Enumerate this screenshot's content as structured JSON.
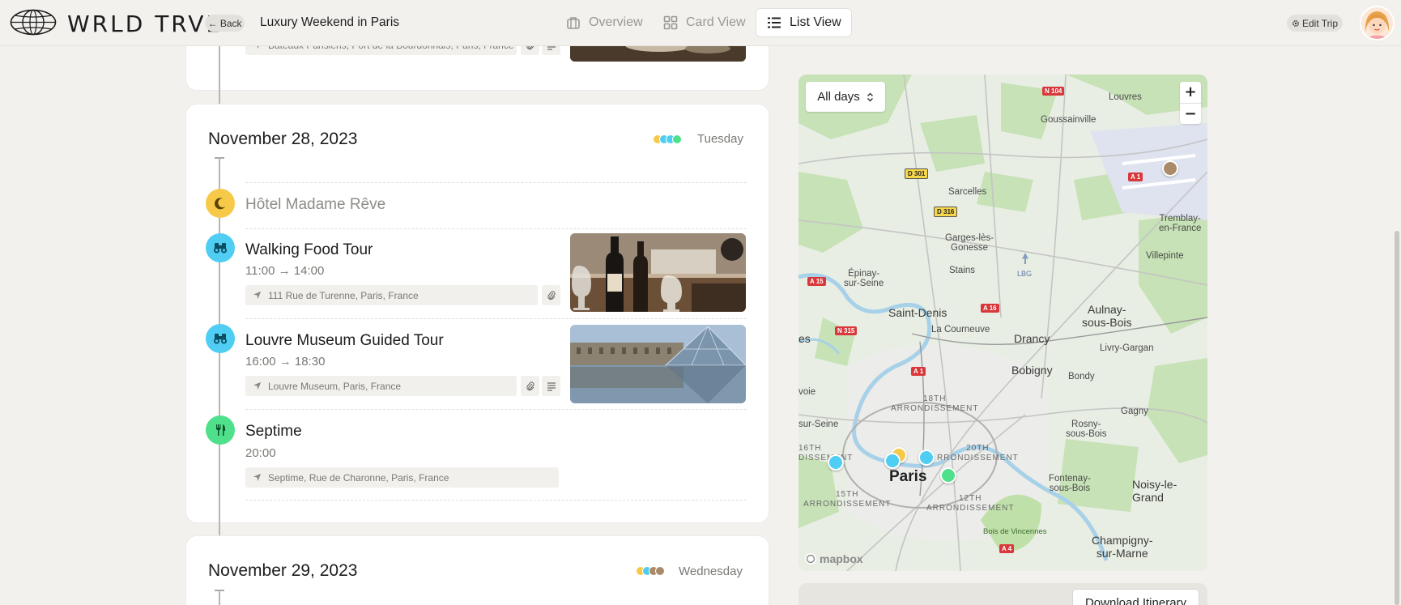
{
  "header": {
    "logo_text": "WRLD TRVL",
    "back_label": "← Back",
    "trip_title": "Luxury Weekend in Paris",
    "tabs": [
      {
        "label": "Overview",
        "icon": "bag-icon",
        "active": false
      },
      {
        "label": "Card View",
        "icon": "grid-icon",
        "active": false
      },
      {
        "label": "List View",
        "icon": "list-icon",
        "active": true
      }
    ],
    "edit_trip_label": "Edit Trip"
  },
  "prev_day": {
    "address": "Bateaux Parisiens, Port de la Bourdonnais, Paris, France"
  },
  "day": {
    "date": "November 28, 2023",
    "weekday": "Tuesday",
    "dot_colors": [
      "#f7c948",
      "#4fcdf2",
      "#4fcdf2",
      "#4ee08a"
    ],
    "items": [
      {
        "type": "lodging",
        "title": "Hôtel Madame Rêve",
        "icon": "moon-icon",
        "color": "#f7c948"
      },
      {
        "type": "activity",
        "title": "Walking Food Tour",
        "time": "11:00 → 14:00",
        "address": "111 Rue de Turenne, Paris, France",
        "icon": "binoculars-icon",
        "color": "#4fcdf2"
      },
      {
        "type": "activity",
        "title": "Louvre Museum Guided Tour",
        "time": "16:00 → 18:30",
        "address": "Louvre Museum, Paris, France",
        "icon": "binoculars-icon",
        "color": "#4fcdf2"
      },
      {
        "type": "restaurant",
        "title": "Septime",
        "time": "20:00",
        "address": "Septime, Rue de Charonne, Paris, France",
        "icon": "fork-knife-icon",
        "color": "#4ee08a"
      }
    ]
  },
  "next_day": {
    "date": "November 29, 2023",
    "weekday": "Wednesday",
    "dot_colors": [
      "#f7c948",
      "#4fcdf2",
      "#a98b6a",
      "#a98b6a"
    ]
  },
  "map": {
    "filter_label": "All days",
    "zoom_in": "+",
    "zoom_out": "−",
    "attribution": "mapbox",
    "labels": {
      "louvres": "Louvres",
      "goussainville": "Goussainville",
      "sarcelles": "Sarcelles",
      "tremblay": "Tremblay-\nen-France",
      "garges": "Garges-lès-\nGonesse",
      "villepinte": "Villepinte",
      "stains": "Stains",
      "lbg": "LBG",
      "epinay": "Épinay-\nsur-Seine",
      "saint_denis": "Saint-Denis",
      "aulnay": "Aulnay-\nsous-Bois",
      "courneuve": "La Courneuve",
      "drancy": "Drancy",
      "livry": "Livry-Gargan",
      "es": "es",
      "bobigny": "Bobigny",
      "bondy": "Bondy",
      "voie": "voie",
      "arr18": "18TH\nARRONDISSEMENT",
      "gagny": "Gagny",
      "sur_seine": "sur-Seine",
      "arr16": "16TH\nDISSEMENT",
      "arr20": "20TH\nRRONDISSEMENT",
      "rosny": "Rosny-\nsous-Bois",
      "paris": "Paris",
      "noisy": "Noisy-le-Grand",
      "arr15": "15TH\nARRONDISSEMENT",
      "arr12": "12TH\nARRONDISSEMENT",
      "fontenay": "Fontenay-\nsous-Bois",
      "vincennes": "Bois de Vincennes",
      "champigny": "Champigny-\nsur-Marne"
    },
    "shields": {
      "n104": "N 104",
      "d301": "D 301",
      "a1a": "A 1",
      "d316": "D 316",
      "a15": "A 15",
      "a16": "A 16",
      "n315": "N 315",
      "a1b": "A 1",
      "a4": "A 4"
    },
    "pin_colors": {
      "blue": "#4fcdf2",
      "yellow": "#f7c948",
      "green": "#4ee08a",
      "brown": "#a98b6a"
    }
  },
  "download_label": "Download Itinerary"
}
